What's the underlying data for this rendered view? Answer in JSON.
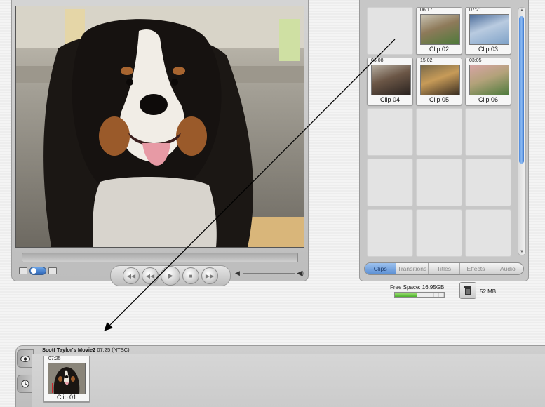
{
  "monitor": {
    "playhead_fraction": 0.0,
    "volume_low_icon": "speaker-low-icon",
    "volume_high_icon": "speaker-high-icon"
  },
  "shelf": {
    "clips": [
      {
        "duration": "06:17",
        "name": "Clip 02",
        "thumb": [
          "#4d7a3a",
          "#8e7a5a",
          "#c9c4b4"
        ]
      },
      {
        "duration": "07:21",
        "name": "Clip 03",
        "thumb": [
          "#7fa2c8",
          "#b9cbe0",
          "#4c6c9a"
        ]
      },
      {
        "duration": "06:08",
        "name": "Clip 04",
        "thumb": [
          "#2a2320",
          "#6b5646",
          "#b6aea1"
        ]
      },
      {
        "duration": "15:02",
        "name": "Clip 05",
        "thumb": [
          "#3a2e22",
          "#c79b58",
          "#7a6a4a"
        ]
      },
      {
        "duration": "03:05",
        "name": "Clip 06",
        "thumb": [
          "#4f7b3d",
          "#b3a27a",
          "#d6a4a4"
        ]
      }
    ],
    "tabs": [
      "Clips",
      "Transitions",
      "Titles",
      "Effects",
      "Audio"
    ],
    "active_tab": "Clips"
  },
  "status": {
    "free_space": "Free Space: 16.95GB",
    "free_space_fraction": 0.45,
    "trash_size": "52 MB"
  },
  "clip_viewer": {
    "title": "Scott Taylor's Movie2",
    "info": "07:25 (NTSC)",
    "clip": {
      "duration": "07:25",
      "name": "Clip 01"
    }
  }
}
